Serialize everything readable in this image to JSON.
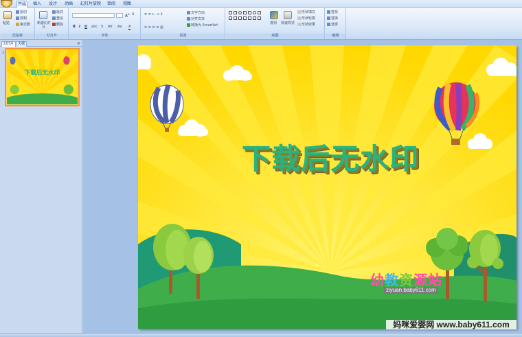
{
  "ribbon_tabs": [
    "开始",
    "插入",
    "设计",
    "动画",
    "幻灯片放映",
    "审阅",
    "视图"
  ],
  "clipboard": {
    "paste": "粘贴",
    "cut": "剪切",
    "copy": "复制",
    "format_painter": "格式刷",
    "label": "剪贴板"
  },
  "slides_group": {
    "new_slide": "新建幻灯片",
    "layout": "版式",
    "reset": "重设",
    "delete": "删除",
    "label": "幻灯片"
  },
  "font_group": {
    "bold": "B",
    "italic": "I",
    "underline": "U",
    "label": "字体"
  },
  "paragraph_group": {
    "text_direction": "文字方向",
    "align_text": "对齐文本",
    "smartart": "转换为 SmartArt",
    "label": "段落"
  },
  "drawing_group": {
    "arrange": "排列",
    "quick_styles": "快速样式",
    "shape_fill": "形状填充",
    "shape_outline": "形状轮廓",
    "shape_effects": "形状效果",
    "label": "绘图"
  },
  "editing_group": {
    "find": "查找",
    "replace": "替换",
    "select": "选择",
    "label": "编辑"
  },
  "panel": {
    "tab_slides": "幻灯片",
    "tab_outline": "大纲",
    "close": "×",
    "slide_number": "1"
  },
  "slide": {
    "title": "下载后无水印",
    "logo_part1": "幼",
    "logo_part2": "教",
    "logo_part3": "资",
    "logo_part4": "源站",
    "logo_url": "ziyuan.baby611.com"
  },
  "watermark": "妈咪爱婴网 www.baby611.com",
  "colors": {
    "slide_bg": "#ffe11c",
    "title": "#2bb37f",
    "grass": "#3fae4a",
    "selection": "#f29436"
  }
}
